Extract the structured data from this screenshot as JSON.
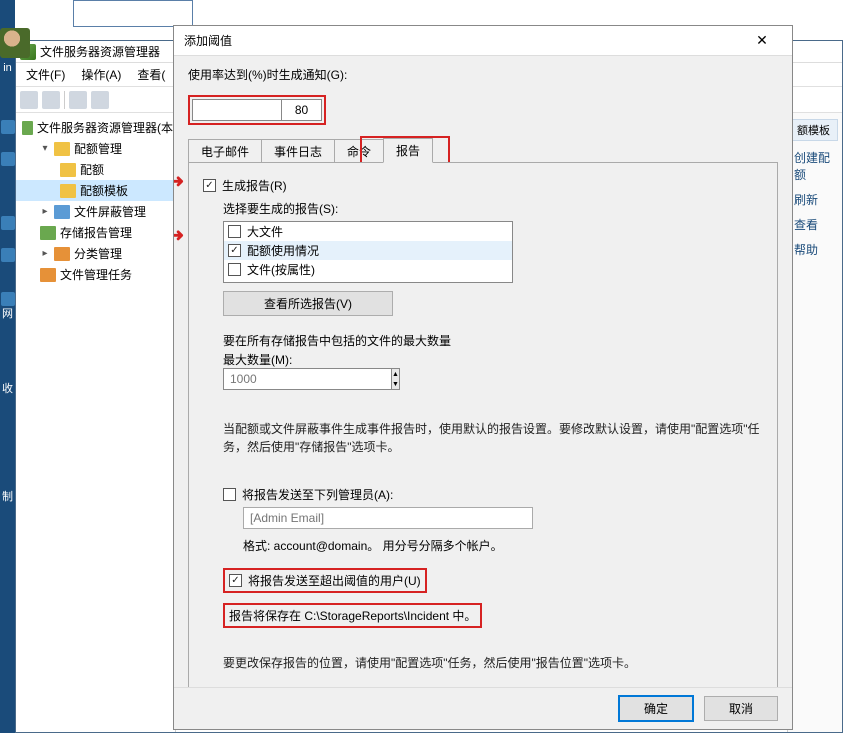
{
  "taskbar": {
    "labels": [
      "in",
      "网",
      "收",
      "制"
    ]
  },
  "fsrm": {
    "title": "文件服务器资源管理器",
    "menu": {
      "file": "文件(F)",
      "action": "操作(A)",
      "view": "查看(",
      "help": ""
    },
    "tree": {
      "root": "文件服务器资源管理器(本",
      "quota_mgmt": "配额管理",
      "quota": "配额",
      "quota_templates": "配额模板",
      "screen_mgmt": "文件屏蔽管理",
      "storage_reports": "存储报告管理",
      "classification": "分类管理",
      "tasks": "文件管理任务"
    },
    "actions": {
      "header": "额模板",
      "create": "创建配额",
      "refresh": "刷新",
      "view": "查看",
      "help": "帮助"
    }
  },
  "dialog": {
    "title": "添加阈值",
    "threshold_label": "使用率达到(%)时生成通知(G):",
    "threshold_value": "80",
    "tabs": {
      "email": "电子邮件",
      "eventlog": "事件日志",
      "command": "命令",
      "report": "报告"
    },
    "generate_reports": "生成报告(R)",
    "select_reports_label": "选择要生成的报告(S):",
    "report_items": {
      "large_files": "大文件",
      "quota_usage": "配额使用情况",
      "files_by_prop": "文件(按属性)"
    },
    "view_selected": "查看所选报告(V)",
    "max_files_label1": "要在所有存储报告中包括的文件的最大数量",
    "max_files_label2": "最大数量(M):",
    "max_files_value": "1000",
    "help1": "当配额或文件屏蔽事件生成事件报告时，使用默认的报告设置。要修改默认设置，请使用\"配置选项\"任务，然后使用\"存储报告\"选项卡。",
    "send_admin": "将报告发送至下列管理员(A):",
    "admin_placeholder": "[Admin Email]",
    "admin_format": "格式: account@domain。 用分号分隔多个帐户。",
    "send_user": "将报告发送至超出阈值的用户(U)",
    "save_path": "报告将保存在 C:\\StorageReports\\Incident 中。",
    "help2": "要更改保存报告的位置，请使用\"配置选项\"任务，然后使用\"报告位置\"选项卡。",
    "ok": "确定",
    "cancel": "取消"
  }
}
